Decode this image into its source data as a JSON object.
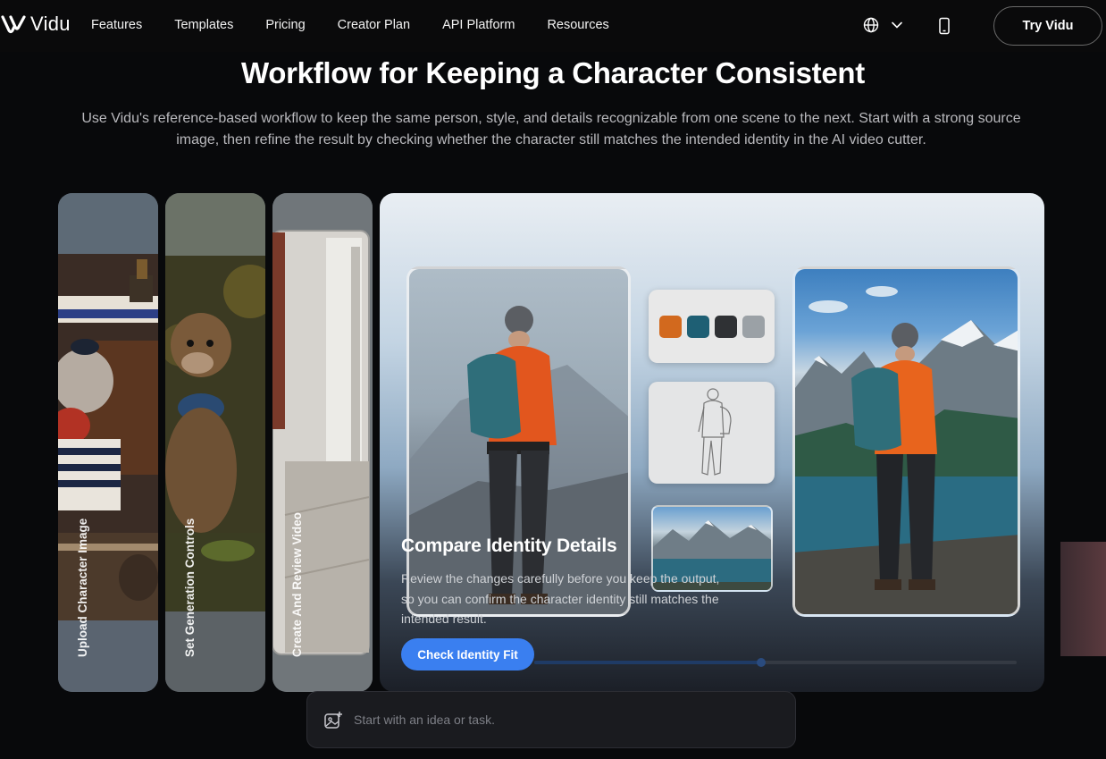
{
  "nav": {
    "logo_text": "Vidu",
    "links": [
      "Features",
      "Templates",
      "Pricing",
      "Creator Plan",
      "API Platform",
      "Resources"
    ],
    "language_icon": "globe-icon",
    "dropdown_icon": "chevron-down-icon",
    "mobile_icon": "phone-icon",
    "cta": "Try Vidu"
  },
  "header": {
    "title": "Workflow for Keeping a Character Consistent",
    "subtitle": "Use Vidu's reference-based workflow to keep the same person, style, and details recognizable from one scene to the next. Start with a strong source image, then refine the result by checking whether the character still matches the intended identity in the AI video cutter."
  },
  "steps": [
    {
      "label": "Upload Character Image"
    },
    {
      "label": "Set Generation Controls"
    },
    {
      "label": "Create And Review Video"
    }
  ],
  "active_step": {
    "title": "Compare Identity Details",
    "description": "Review the changes carefully before you keep the output, so you can confirm the character identity still matches the intended result.",
    "button": "Check Identity Fit",
    "progress": 0.47,
    "swatches": [
      "#d2691e",
      "#1e5f74",
      "#2f3134",
      "#9ba1a6"
    ]
  },
  "prompt": {
    "placeholder": "Start with an idea or task.",
    "icon": "image-add-icon"
  },
  "colors": {
    "background": "#08090b",
    "accent": "#3a7ff0"
  }
}
